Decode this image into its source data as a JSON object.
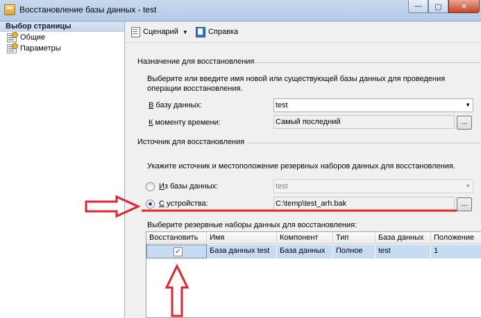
{
  "window": {
    "title": "Восстановление базы данных - test"
  },
  "window_buttons": {
    "minimize": "—",
    "maximize": "▢",
    "close": "✕"
  },
  "left_pane": {
    "header": "Выбор страницы",
    "items": [
      "Общие",
      "Параметры"
    ]
  },
  "toolbar": {
    "script_label": "Сценарий",
    "help_label": "Справка"
  },
  "destination": {
    "section_title": "Назначение для восстановления",
    "description_line1": "Выберите или введите имя новой или существующей базы данных для проведения",
    "description_line2": "операции восстановления.",
    "db_label_accel": "В",
    "db_label_rest": " базу данных:",
    "db_value": "test",
    "time_label_accel": "К",
    "time_label_rest": " моменту времени:",
    "time_value": "Самый последний",
    "browse_label": "..."
  },
  "source": {
    "section_title": "Источник для восстановления",
    "description": "Укажите источник и местоположение резервных наборов данных для восстановления.",
    "from_db_label_accel": "И",
    "from_db_label_rest": "з базы данных:",
    "from_db_value": "test",
    "from_device_label_accel": "С",
    "from_device_label_rest": " устройства:",
    "from_device_value": "C:\\temp\\test_arh.bak",
    "selected_option": "from_device",
    "browse_label": "..."
  },
  "backup_sets": {
    "label": "Выберите резервные наборы данных для восстановления:",
    "columns": [
      "Восстановить",
      "Имя",
      "Компонент",
      "Тип",
      "База данных",
      "Положение"
    ],
    "rows": [
      {
        "restore": true,
        "check_glyph": "✓",
        "name": "База данных test",
        "component": "База данных",
        "type": "Полное",
        "database": "test",
        "position": "1"
      }
    ]
  },
  "colors": {
    "annotation": "#e3232b",
    "selection": "#c7dcf2"
  }
}
